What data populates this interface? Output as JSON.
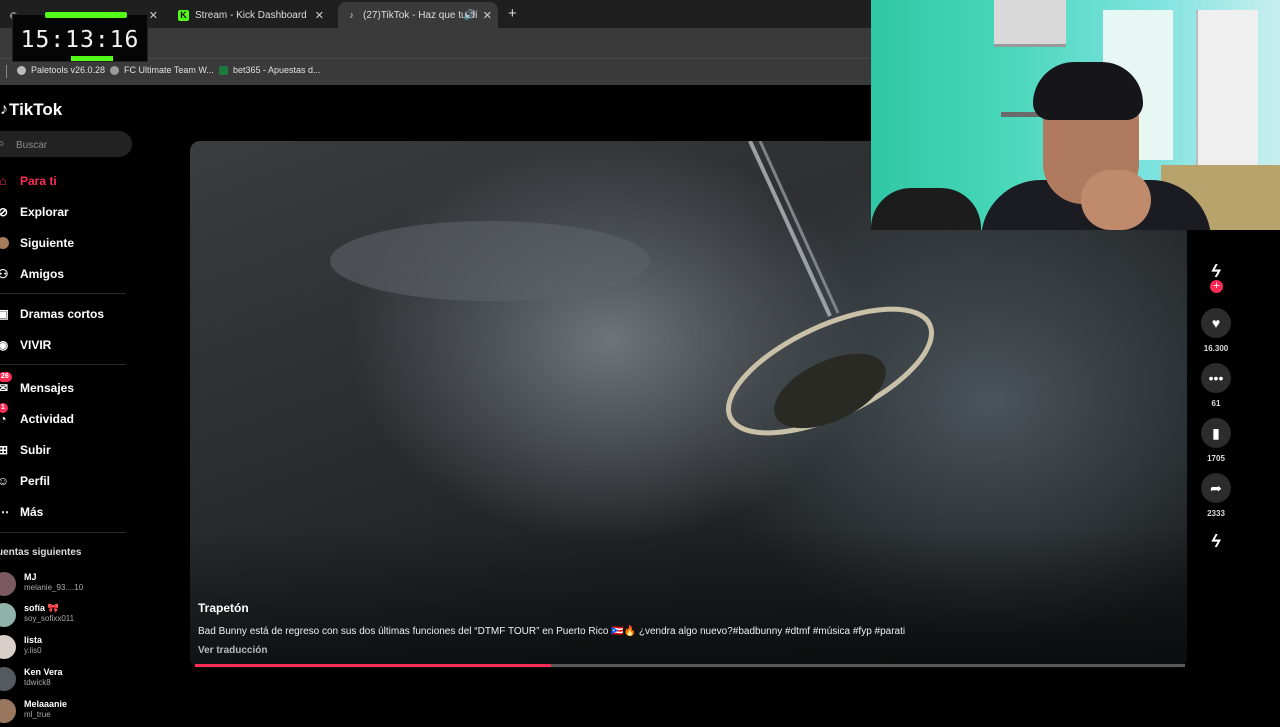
{
  "browser": {
    "tabs": [
      {
        "label": "",
        "active": false,
        "icon": "overlay-tab-icon"
      },
      {
        "label": "Stream - Kick Dashboard",
        "active": false,
        "icon": "kick-icon"
      },
      {
        "label": "(27)TikTok - Haz que tu dí",
        "active": true,
        "icon": "tiktok-icon"
      }
    ],
    "bookmarks": [
      {
        "label": "Paletools v26.0.28",
        "icon": "paletools-icon"
      },
      {
        "label": "FC Ultimate Team W...",
        "icon": "fc-icon"
      },
      {
        "label": "bet365 - Apuestas d...",
        "icon": "bet365-icon"
      }
    ]
  },
  "overlay": {
    "clock": "15:13:16",
    "bar_text": "",
    "under_text": ""
  },
  "tiktok": {
    "logo": "TikTok",
    "search_placeholder": "Buscar",
    "nav": [
      {
        "label": "Para ti",
        "icon": "home-icon",
        "active": true
      },
      {
        "label": "Explorar",
        "icon": "compass-icon"
      },
      {
        "label": "Siguiente",
        "icon": "following-avatar-icon"
      },
      {
        "label": "Amigos",
        "icon": "friends-icon"
      },
      {
        "label": "Dramas cortos",
        "icon": "film-icon"
      },
      {
        "label": "VIVIR",
        "icon": "live-icon"
      },
      {
        "label": "Mensajes",
        "icon": "message-icon",
        "badge": "26"
      },
      {
        "label": "Actividad",
        "icon": "activity-icon",
        "badge": "1"
      },
      {
        "label": "Subir",
        "icon": "upload-icon"
      },
      {
        "label": "Perfil",
        "icon": "profile-icon"
      },
      {
        "label": "Más",
        "icon": "more-icon"
      }
    ],
    "following_title": "uentas siguientes",
    "following": [
      {
        "name": "MJ",
        "user": "melanie_93....10"
      },
      {
        "name": "sofía 🎀",
        "user": "soy_sofixx011"
      },
      {
        "name": "lista",
        "user": "y.lis0"
      },
      {
        "name": "Ken Vera",
        "user": "tdwick8"
      },
      {
        "name": "Melaaanie",
        "user": "ml_true"
      }
    ],
    "video": {
      "author": "Trapetón",
      "description": "Bad Bunny está de regreso con sus dos últimas funciones del “DTMF TOUR” en Puerto Rico 🇵🇷🔥 ¿vendra algo nuevo?#badbunny #dtmf #música #fyp #parati",
      "translate": "Ver traducción",
      "progress": 0.36
    },
    "actions": {
      "likes": "16.300",
      "comments": "61",
      "saves": "1705",
      "shares": "2333"
    }
  }
}
